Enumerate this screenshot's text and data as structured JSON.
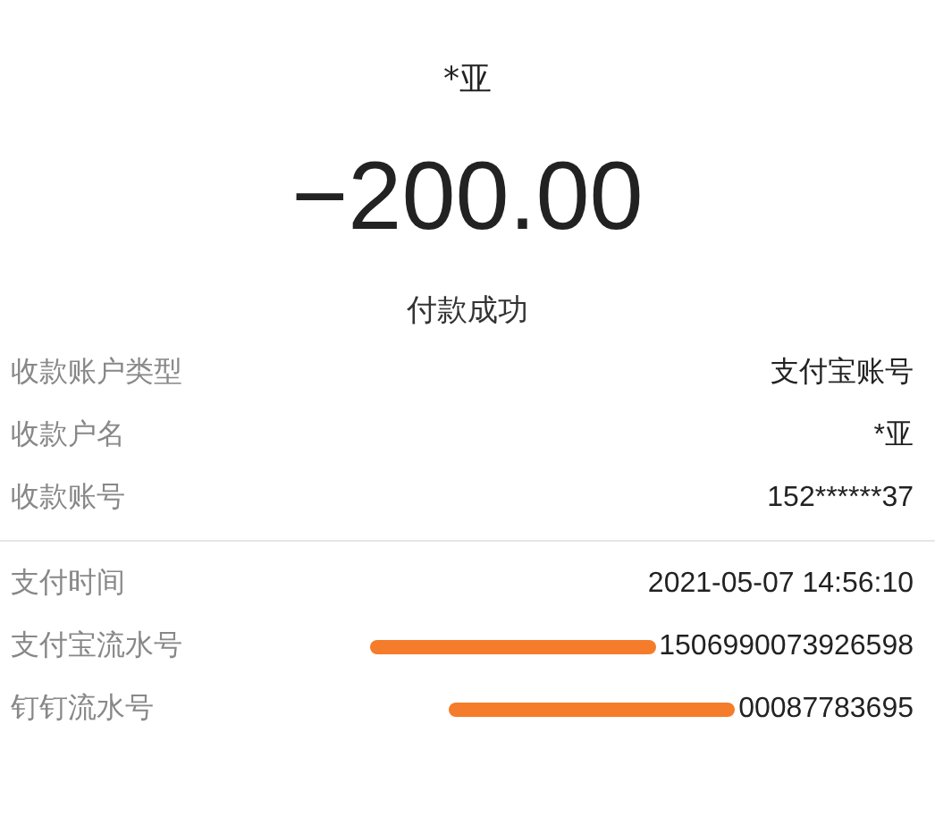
{
  "header": {
    "payee": "*亚",
    "amount": "−200.00",
    "status": "付款成功"
  },
  "sections": [
    {
      "rows": [
        {
          "label": "收款账户类型",
          "value": "支付宝账号",
          "redacted": false
        },
        {
          "label": "收款户名",
          "value": "*亚",
          "redacted": false
        },
        {
          "label": "收款账号",
          "value": "152******37",
          "redacted": false
        }
      ]
    },
    {
      "rows": [
        {
          "label": "支付时间",
          "value": "2021-05-07 14:56:10",
          "redacted": false
        },
        {
          "label": "支付宝流水号",
          "value": "1506990073926598",
          "redacted": true
        },
        {
          "label": "钉钉流水号",
          "value": "00087783695",
          "redacted": true
        }
      ]
    }
  ]
}
